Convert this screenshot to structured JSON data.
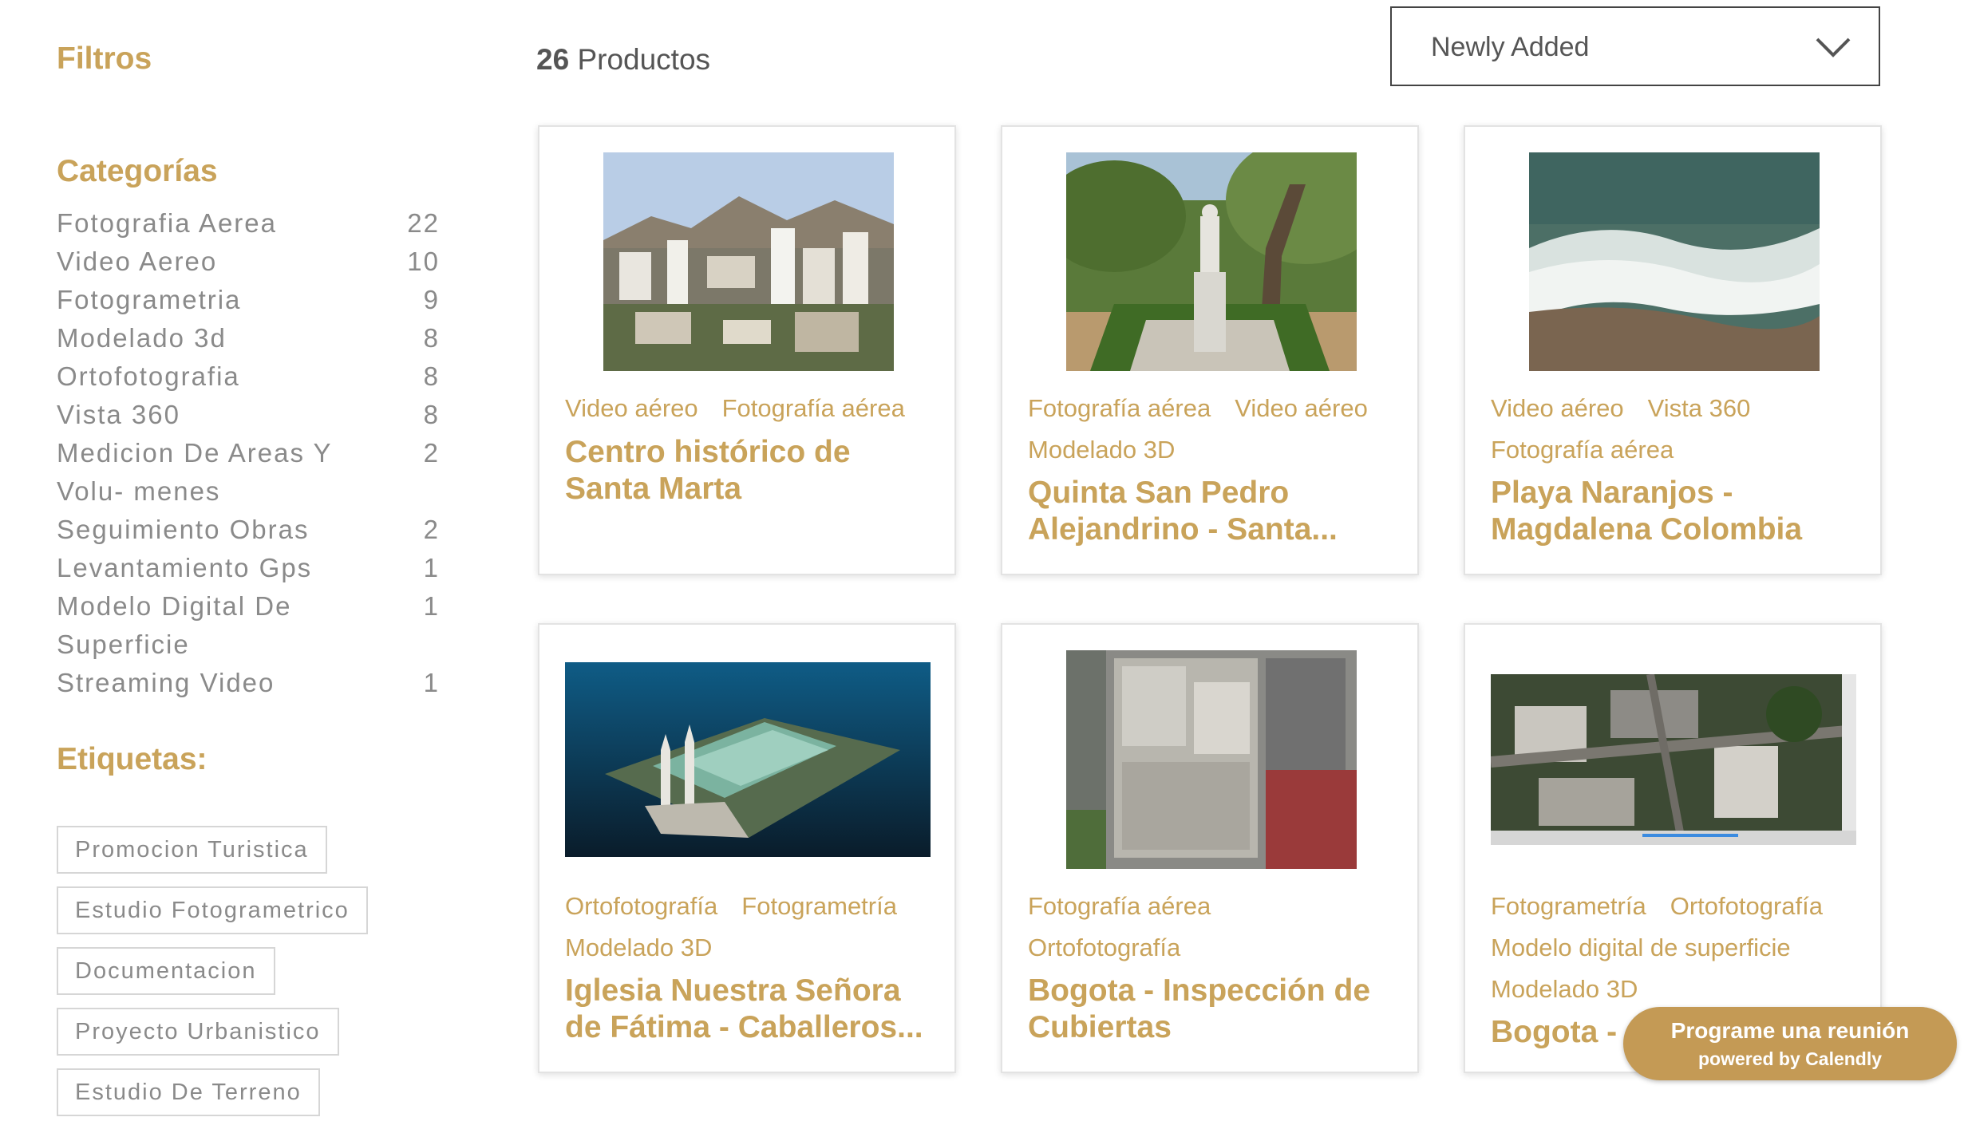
{
  "sidebar": {
    "filters_title": "Filtros",
    "categories_title": "Categorías",
    "categories": [
      {
        "name": "Fotografia Aerea",
        "count": "22"
      },
      {
        "name": "Video Aereo",
        "count": "10"
      },
      {
        "name": "Fotogrametria",
        "count": "9"
      },
      {
        "name": "Modelado 3d",
        "count": "8"
      },
      {
        "name": "Ortofotografia",
        "count": "8"
      },
      {
        "name": "Vista 360",
        "count": "8"
      },
      {
        "name": "Medicion De Areas Y Volu- menes",
        "count": "2"
      },
      {
        "name": "Seguimiento Obras",
        "count": "2"
      },
      {
        "name": "Levantamiento Gps",
        "count": "1"
      },
      {
        "name": "Modelo Digital De Superficie",
        "count": "1"
      },
      {
        "name": "Streaming Video",
        "count": "1"
      }
    ],
    "tags_title": "Etiquetas:",
    "tags": [
      "Promocion Turistica",
      "Estudio Fotogrametrico",
      "Documentacion",
      "Proyecto Urbanistico",
      "Estudio De Terreno"
    ]
  },
  "header": {
    "product_count": "26",
    "product_label": "Productos",
    "sort_value": "Newly Added"
  },
  "products": [
    {
      "tags": [
        "Video aéreo",
        "Fotografía aérea"
      ],
      "title": "Centro histórico de Santa Marta"
    },
    {
      "tags": [
        "Fotografía aérea",
        "Video aéreo",
        "Modelado 3D"
      ],
      "title": "Quinta San Pedro Alejandrino - Santa..."
    },
    {
      "tags": [
        "Video aéreo",
        "Vista 360",
        "Fotografía aérea"
      ],
      "title": "Playa Naranjos - Magdalena Colombia"
    },
    {
      "tags": [
        "Ortofotografía",
        "Fotogrametría",
        "Modelado 3D"
      ],
      "title": "Iglesia Nuestra Señora de Fátima - Caballeros..."
    },
    {
      "tags": [
        "Fotografía aérea",
        "Ortofotografía"
      ],
      "title": "Bogota - Inspección de Cubiertas"
    },
    {
      "tags": [
        "Fotogrametría",
        "Ortofotografía",
        "Modelo digital de superficie",
        "Modelado 3D"
      ],
      "title": "Bogota - "
    }
  ],
  "calendly": {
    "main": "Programe una reunión",
    "sub": "powered by Calendly"
  },
  "colors": {
    "accent": "#c9a35a",
    "text_gray": "#8a8a8a",
    "calendly_bg": "#c49a55"
  },
  "icons": {
    "sort": "chevron-down-icon"
  }
}
